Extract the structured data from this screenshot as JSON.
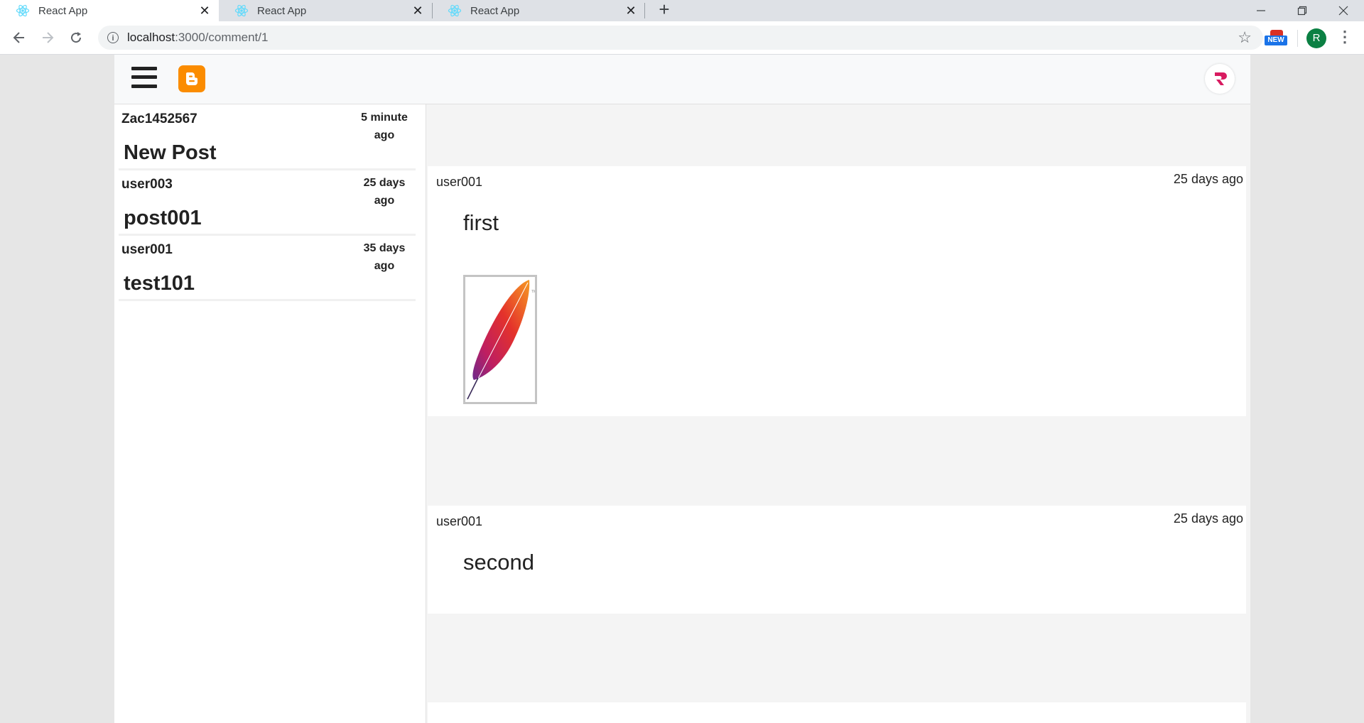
{
  "browser": {
    "tabs": [
      {
        "title": "React App",
        "active": true
      },
      {
        "title": "React App",
        "active": false
      },
      {
        "title": "React App",
        "active": false
      }
    ],
    "url_host": "localhost",
    "url_path": ":3000/comment/1",
    "extension_badge": "NEW",
    "profile_initial": "R",
    "colors": {
      "profile": "#0b8043",
      "tab_strip": "#dee1e6"
    }
  },
  "app": {
    "colors": {
      "blogger": "#fb8c00",
      "brand": "#d81b60"
    },
    "posts": [
      {
        "author": "Zac1452567",
        "time_line1": "5 minute",
        "time_line2": "ago",
        "title": "New Post"
      },
      {
        "author": "user003",
        "time_line1": "25 days",
        "time_line2": "ago",
        "title": "post001"
      },
      {
        "author": "user001",
        "time_line1": "35 days",
        "time_line2": "ago",
        "title": "test101"
      }
    ],
    "comments": [
      {
        "user": "user001",
        "time": "25 days ago",
        "text": "first",
        "image_icon": "apache-feather-icon"
      },
      {
        "user": "user001",
        "time": "25 days ago",
        "text": "second"
      }
    ]
  }
}
